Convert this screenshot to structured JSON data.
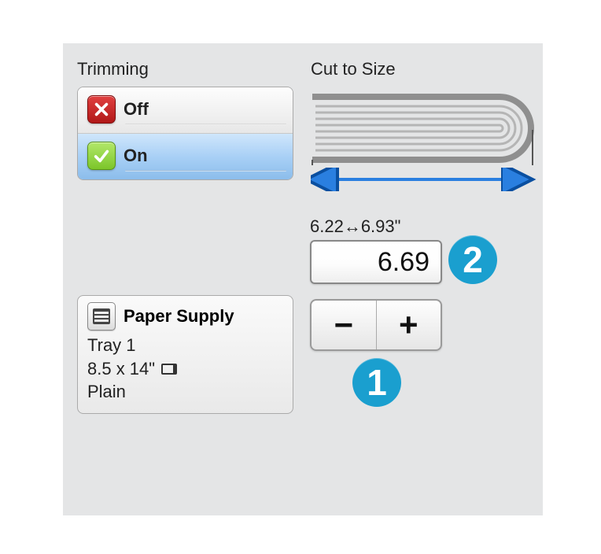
{
  "trimming": {
    "title": "Trimming",
    "off_label": "Off",
    "on_label": "On"
  },
  "cut": {
    "title": "Cut to Size",
    "range_label": "6.22↔6.93\"",
    "value": "6.69",
    "minus": "−",
    "plus": "+"
  },
  "callouts": {
    "badge1": "1",
    "badge2": "2"
  },
  "paper": {
    "title": "Paper Supply",
    "tray": "Tray 1",
    "size": "8.5 x 14\"",
    "type": "Plain"
  }
}
